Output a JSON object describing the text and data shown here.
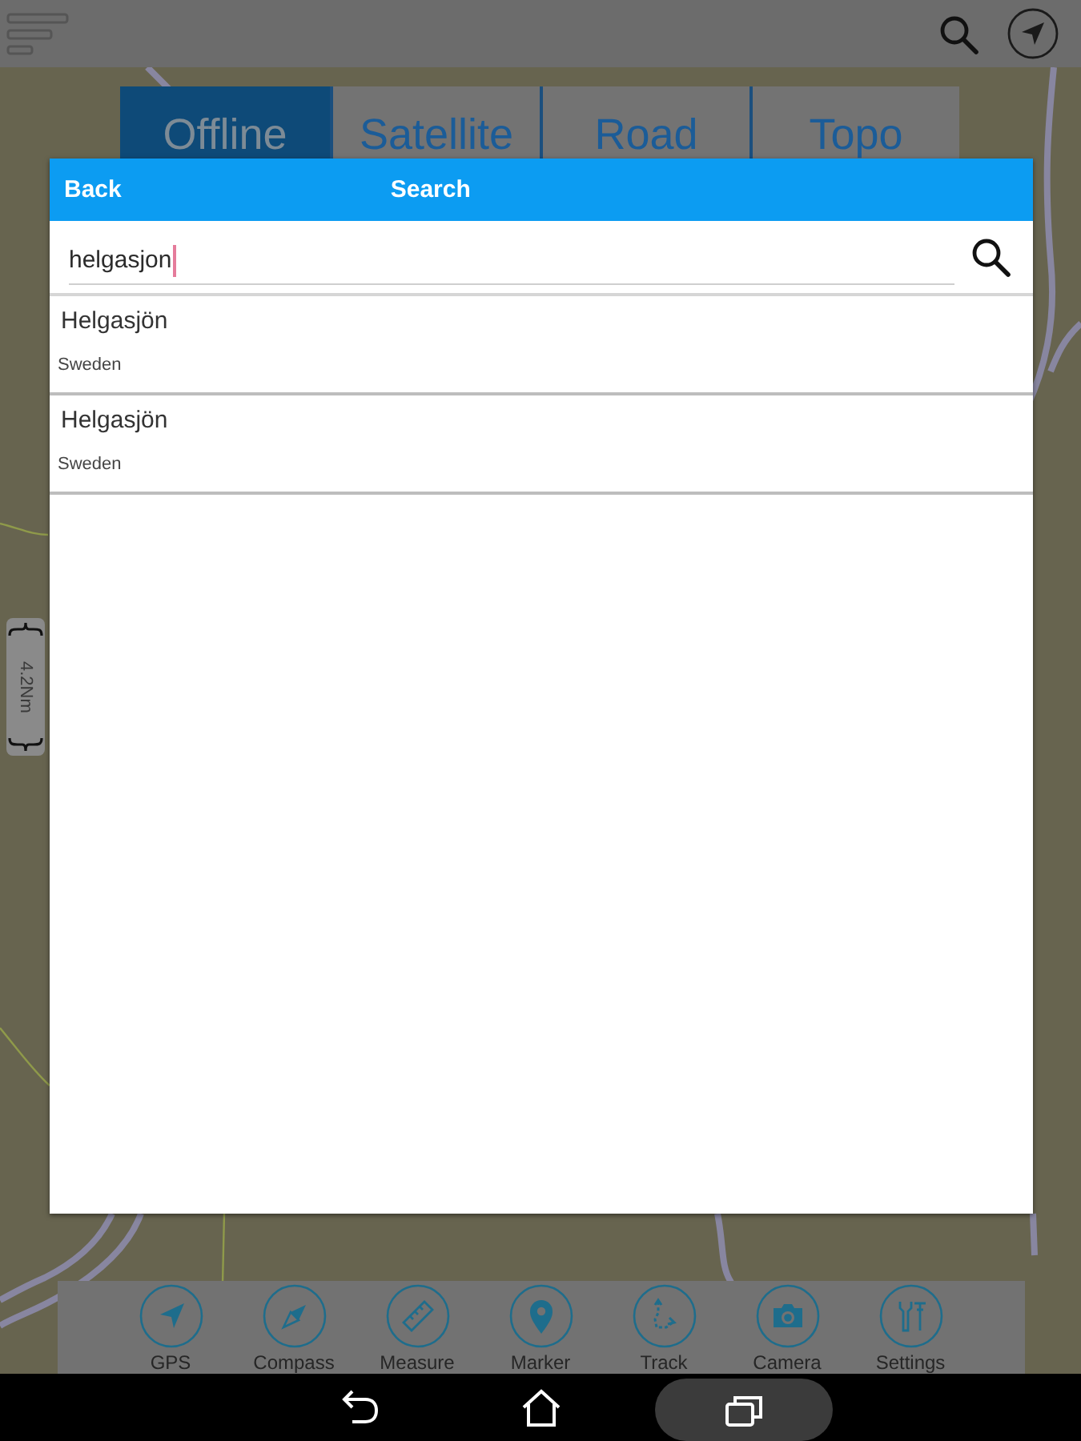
{
  "map_tabs": [
    {
      "label": "Offline",
      "selected": true
    },
    {
      "label": "Satellite",
      "selected": false
    },
    {
      "label": "Road",
      "selected": false
    },
    {
      "label": "Topo",
      "selected": false
    }
  ],
  "scale_bar": {
    "label": "4.2Nm"
  },
  "search_dialog": {
    "back": "Back",
    "title": "Search",
    "query": "helgasjon",
    "results": [
      {
        "name": "Helgasjön",
        "country": "Sweden"
      },
      {
        "name": "Helgasjön",
        "country": "Sweden"
      }
    ]
  },
  "toolbar": [
    {
      "kind": "gps",
      "label": "GPS"
    },
    {
      "kind": "compass",
      "label": "Compass"
    },
    {
      "kind": "measure",
      "label": "Measure"
    },
    {
      "kind": "marker",
      "label": "Marker"
    },
    {
      "kind": "track",
      "label": "Track"
    },
    {
      "kind": "camera",
      "label": "Camera"
    },
    {
      "kind": "settings",
      "label": "Settings"
    }
  ]
}
